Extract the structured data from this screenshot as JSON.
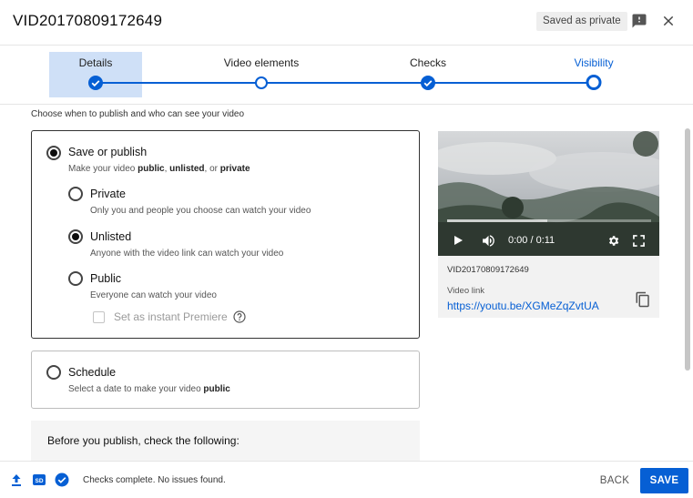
{
  "header": {
    "title": "VID20170809172649",
    "status_badge": "Saved as private",
    "icons": {
      "feedback": "feedback-icon",
      "close": "close-icon"
    }
  },
  "stepper": {
    "steps": [
      {
        "label": "Details",
        "state": "done-active"
      },
      {
        "label": "Video elements",
        "state": "open"
      },
      {
        "label": "Checks",
        "state": "done"
      },
      {
        "label": "Visibility",
        "state": "current"
      }
    ]
  },
  "visibility": {
    "subtitle": "Choose when to publish and who can see your video",
    "save_or_publish": {
      "title": "Save or publish",
      "desc_pre": "Make your video ",
      "desc_b1": "public",
      "desc_sep1": ", ",
      "desc_b2": "unlisted",
      "desc_sep2": ", or ",
      "desc_b3": "private",
      "selected": true,
      "options": [
        {
          "title": "Private",
          "desc": "Only you and people you choose can watch your video",
          "selected": false
        },
        {
          "title": "Unlisted",
          "desc": "Anyone with the video link can watch your video",
          "selected": true
        },
        {
          "title": "Public",
          "desc": "Everyone can watch your video",
          "selected": false
        }
      ],
      "premiere_label": "Set as instant Premiere"
    },
    "schedule": {
      "title": "Schedule",
      "desc_pre": "Select a date to make your video ",
      "desc_b": "public",
      "selected": false
    },
    "before_publish": "Before you publish, check the following:"
  },
  "preview": {
    "time": "0:00 / 0:11",
    "progress_fraction": 0,
    "buffered_fraction": 0.49,
    "filename": "VID20170809172649",
    "link_label": "Video link",
    "link": "https://youtu.be/XGMeZqZvtUA"
  },
  "footer": {
    "status": "Checks complete. No issues found.",
    "back_label": "BACK",
    "save_label": "SAVE",
    "quality_badge": "SD"
  },
  "colors": {
    "accent": "#065fd4",
    "active_step_bg": "#cfe0f7"
  }
}
